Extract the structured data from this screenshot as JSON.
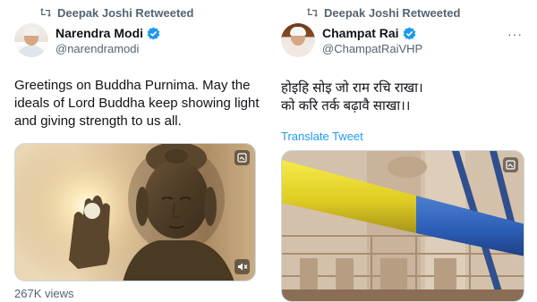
{
  "tweets": [
    {
      "retweeted_by": "Deepak Joshi Retweeted",
      "author_name": "Narendra Modi",
      "author_handle": "@narendramodi",
      "text": "Greetings on Buddha Purnima. May the ideals of Lord Buddha keep showing light and giving strength to us all.",
      "media_icon": "gif-badge-icon",
      "mute_icon": "speaker-muted-icon",
      "views": "267K views"
    },
    {
      "retweeted_by": "Deepak Joshi Retweeted",
      "author_name": "Champat Rai",
      "author_handle": "@ChampatRaiVHP",
      "more": "···",
      "text_line1": "होइहि सोइ जो राम रचि राखा।",
      "text_line2": "को करि तर्क बढ़ावै साखा।।",
      "translate": "Translate Tweet",
      "media_icon": "gif-badge-icon"
    }
  ],
  "colors": {
    "accent": "#1d9bf0",
    "secondary_text": "#536471",
    "primary_text": "#0f1419"
  }
}
